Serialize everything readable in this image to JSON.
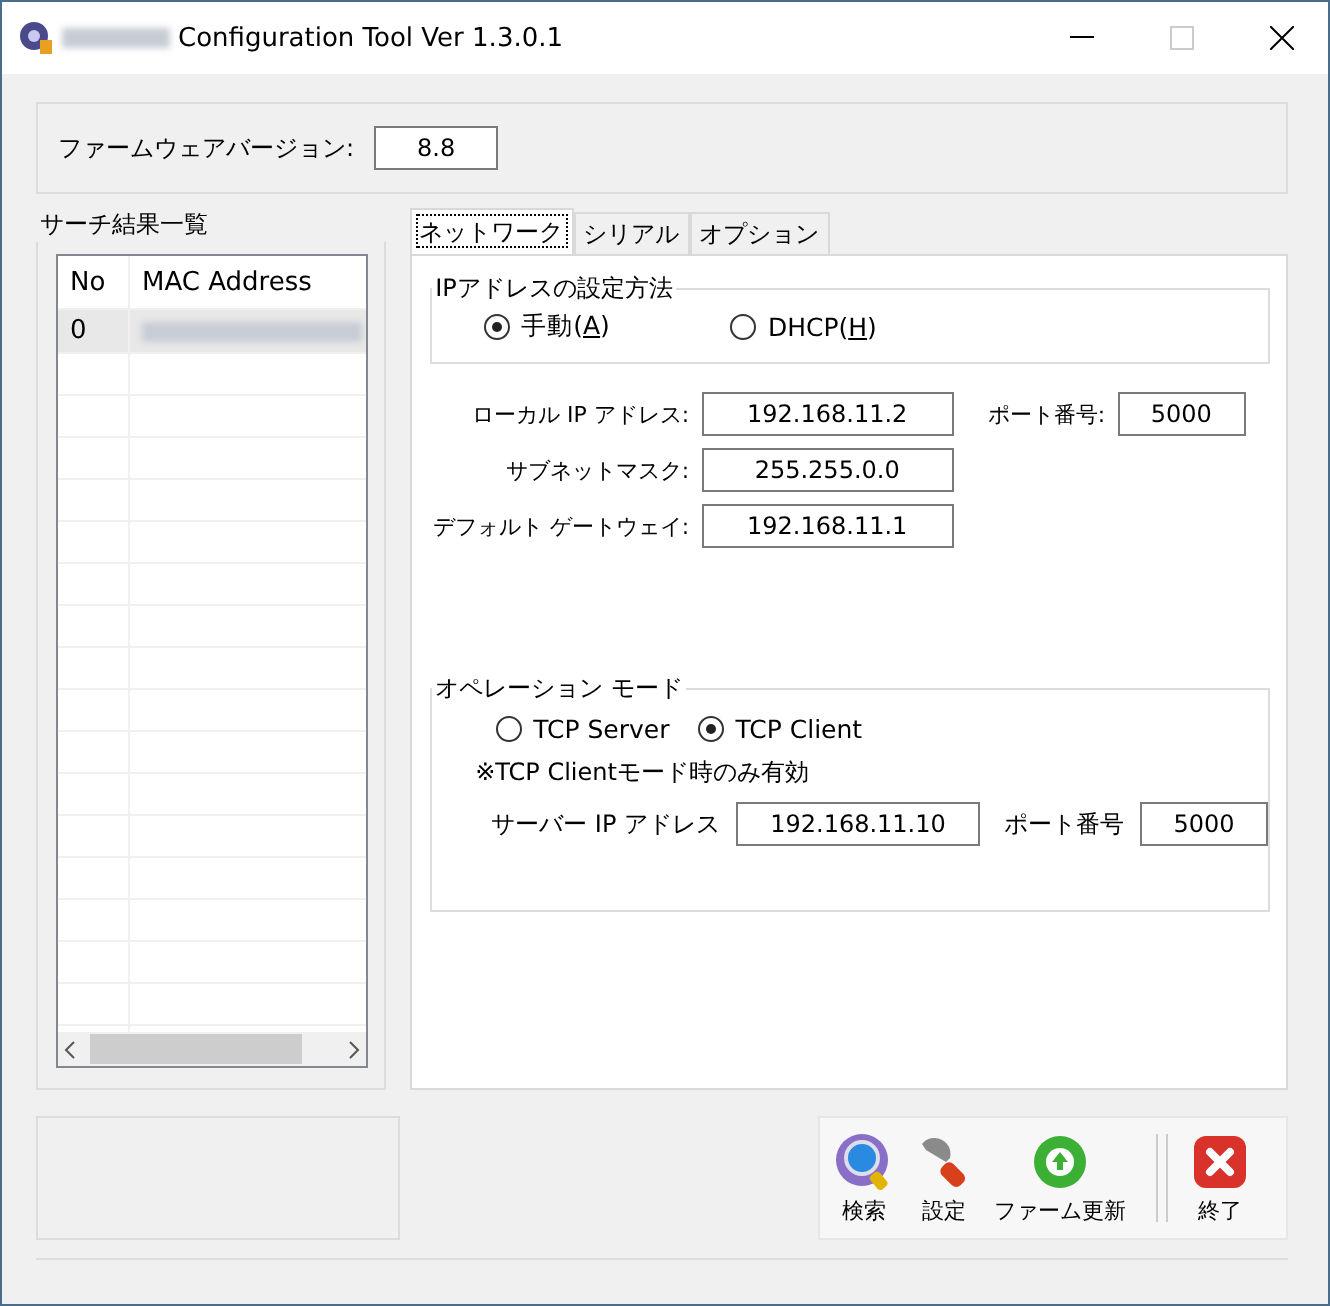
{
  "window": {
    "title": "Configuration Tool Ver 1.3.0.1"
  },
  "firmware": {
    "label": "ファームウェアバージョン:",
    "value": "8.8"
  },
  "search_results": {
    "title": "サーチ結果一覧",
    "columns": [
      "No",
      "MAC Address"
    ],
    "rows": [
      {
        "no": "0",
        "selected": true
      }
    ]
  },
  "tabs": [
    {
      "label": "ネットワーク",
      "selected": true
    },
    {
      "label": "シリアル",
      "selected": false
    },
    {
      "label": "オプション",
      "selected": false
    }
  ],
  "ip_method": {
    "title": "IPアドレスの設定方法",
    "options": [
      {
        "parts": [
          "手動(",
          "A",
          ")"
        ],
        "selected": true
      },
      {
        "parts": [
          "DHCP(",
          "H",
          ")"
        ],
        "selected": false
      }
    ]
  },
  "network": {
    "local_ip": {
      "label": "ローカル IP アドレス:",
      "value": "192.168.11.2"
    },
    "port": {
      "label": "ポート番号:",
      "value": "5000"
    },
    "subnet": {
      "label": "サブネットマスク:",
      "value": "255.255.0.0"
    },
    "gateway": {
      "label": "デフォルト ゲートウェイ:",
      "value": "192.168.11.1"
    }
  },
  "operation_mode": {
    "title": "オペレーション モード",
    "options": [
      {
        "label": "TCP Server",
        "selected": false
      },
      {
        "label": "TCP Client",
        "selected": true
      }
    ],
    "note": "※TCP Clientモード時のみ有効",
    "server_ip": {
      "label": "サーバー IP アドレス",
      "value": "192.168.11.10"
    },
    "port": {
      "label": "ポート番号",
      "value": "5000"
    }
  },
  "toolbar": [
    {
      "kind": "search",
      "label": "検索"
    },
    {
      "kind": "settings",
      "label": "設定"
    },
    {
      "kind": "update",
      "label": "ファーム更新"
    },
    {
      "kind": "exit",
      "label": "終了"
    }
  ]
}
